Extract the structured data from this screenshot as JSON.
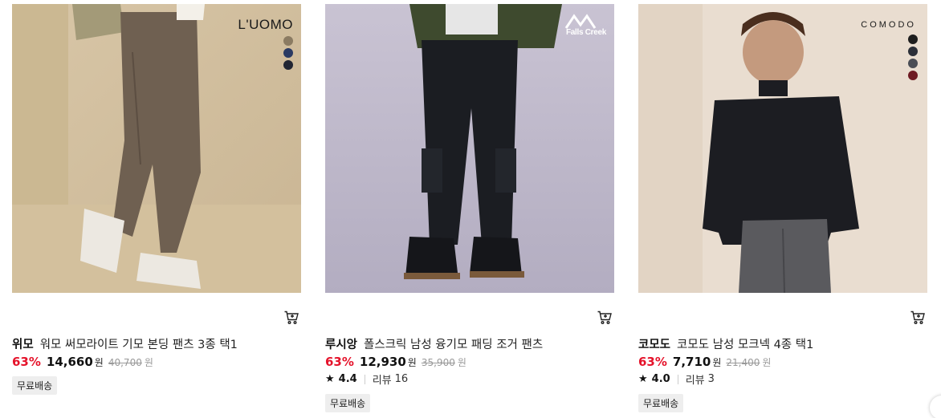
{
  "products": [
    {
      "brand": "위모",
      "name": "워모 써모라이트 기모 본딩 팬츠 3종 택1",
      "discount": "63%",
      "price": "14,660",
      "price_unit": "원",
      "original_price": "40,700",
      "original_unit": "원",
      "badge": "무료배송",
      "logo_text": "L'UOMO",
      "swatch_colors": [
        "#8b7b62",
        "#2a3a63",
        "#222634"
      ]
    },
    {
      "brand": "루시앙",
      "name": "폴스크릭 남성 융기모 패딩 조거 팬츠",
      "discount": "63%",
      "price": "12,930",
      "price_unit": "원",
      "original_price": "35,900",
      "original_unit": "원",
      "rating": "4.4",
      "review_label": "리뷰",
      "review_count": "16",
      "badge": "무료배송",
      "logo_text": "Falls Creek"
    },
    {
      "brand": "코모도",
      "name": "코모도 남성 모크넥 4종 택1",
      "discount": "63%",
      "price": "7,710",
      "price_unit": "원",
      "original_price": "21,400",
      "original_unit": "원",
      "rating": "4.0",
      "review_label": "리뷰",
      "review_count": "3",
      "badge": "무료배송",
      "logo_text": "COMODO",
      "swatch_colors": [
        "#1e1e1e",
        "#2b2f38",
        "#4a4d55",
        "#6e1a22"
      ]
    }
  ],
  "icons": {
    "cart": "cart-icon",
    "star": "star-icon"
  }
}
